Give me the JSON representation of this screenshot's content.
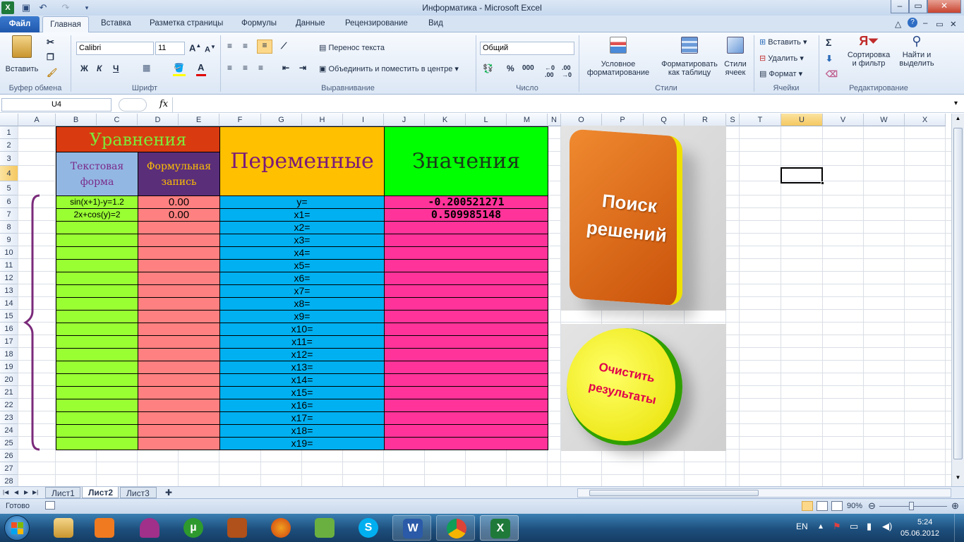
{
  "window": {
    "title": "Информатика  -  Microsoft Excel",
    "min": "–",
    "max": "▭",
    "close": "✕"
  },
  "tabs": [
    "Файл",
    "Главная",
    "Вставка",
    "Разметка страницы",
    "Формулы",
    "Данные",
    "Рецензирование",
    "Вид"
  ],
  "ribbon": {
    "paste": "Вставить",
    "clipboard": "Буфер обмена",
    "font_name": "Calibri",
    "font_size": "11",
    "bold": "Ж",
    "italic": "К",
    "underline": "Ч",
    "font_group": "Шрифт",
    "wrap_text": "Перенос текста",
    "merge_center": "Объединить и поместить в центре",
    "alignment_group": "Выравнивание",
    "number_format": "Общий",
    "percent": "%",
    "thousands": "000",
    "number_group": "Число",
    "cond_format_1": "Условное",
    "cond_format_2": "форматирование",
    "format_table_1": "Форматировать",
    "format_table_2": "как таблицу",
    "cell_styles_1": "Стили",
    "cell_styles_2": "ячеек",
    "styles_group": "Стили",
    "insert": "Вставить",
    "delete": "Удалить",
    "format": "Формат",
    "cells_group": "Ячейки",
    "sum": "Σ",
    "sort_1": "Сортировка",
    "sort_2": "и фильтр",
    "find_1": "Найти и",
    "find_2": "выделить",
    "editing_group": "Редактирование"
  },
  "formula_bar": {
    "name_box": "U4",
    "fx": "fx",
    "value": ""
  },
  "columns": [
    "A",
    "B",
    "C",
    "D",
    "E",
    "F",
    "G",
    "H",
    "I",
    "J",
    "K",
    "L",
    "M",
    "N",
    "O",
    "P",
    "Q",
    "R",
    "S",
    "T",
    "U",
    "V",
    "W",
    "X"
  ],
  "rows": [
    "1",
    "2",
    "3",
    "4",
    "5",
    "6",
    "7",
    "8",
    "9",
    "10",
    "11",
    "12",
    "13",
    "14",
    "15",
    "16",
    "17",
    "18",
    "19",
    "20",
    "21",
    "22",
    "23",
    "24",
    "25",
    "26",
    "27",
    "28"
  ],
  "table": {
    "header_equations": "Уравнения",
    "header_text_form_1": "Текстовая",
    "header_text_form_2": "форма",
    "header_formula_1": "Формульная",
    "header_formula_2": "запись",
    "header_variables": "Переменные",
    "header_values": "Значения",
    "equations": [
      "sin(x+1)-y=1.2",
      "2x+cos(y)=2"
    ],
    "formula_values": [
      "0.00",
      "0.00"
    ],
    "variables": [
      "y=",
      "x1=",
      "x2=",
      "x3=",
      "x4=",
      "x5=",
      "x6=",
      "x7=",
      "x8=",
      "x9=",
      "x10=",
      "x11=",
      "x12=",
      "x13=",
      "x14=",
      "x15=",
      "x16=",
      "x17=",
      "x18=",
      "x19="
    ],
    "values": [
      "-0.200521271",
      "0.509985148"
    ]
  },
  "buttons": {
    "solver_1": "Поиск",
    "solver_2": "решений",
    "clear_1": "Очистить",
    "clear_2": "результаты"
  },
  "sheets": [
    "Лист1",
    "Лист2",
    "Лист3"
  ],
  "status": {
    "ready": "Готово",
    "zoom": "90%"
  },
  "tray": {
    "lang": "EN",
    "time": "5:24",
    "date": "05.06.2012"
  },
  "colors": {
    "eq_header": "#d93a10",
    "eq_title_text": "#7ee83a",
    "text_form": "#93b7e3",
    "formula_header": "#5b2e7a",
    "variables": "#ffc000",
    "values_header": "#00ff00",
    "green": "#99ff33",
    "salmon": "#ff8080",
    "blue": "#00b0f0",
    "magenta": "#ff3399",
    "brace": "#7a2a7a"
  }
}
